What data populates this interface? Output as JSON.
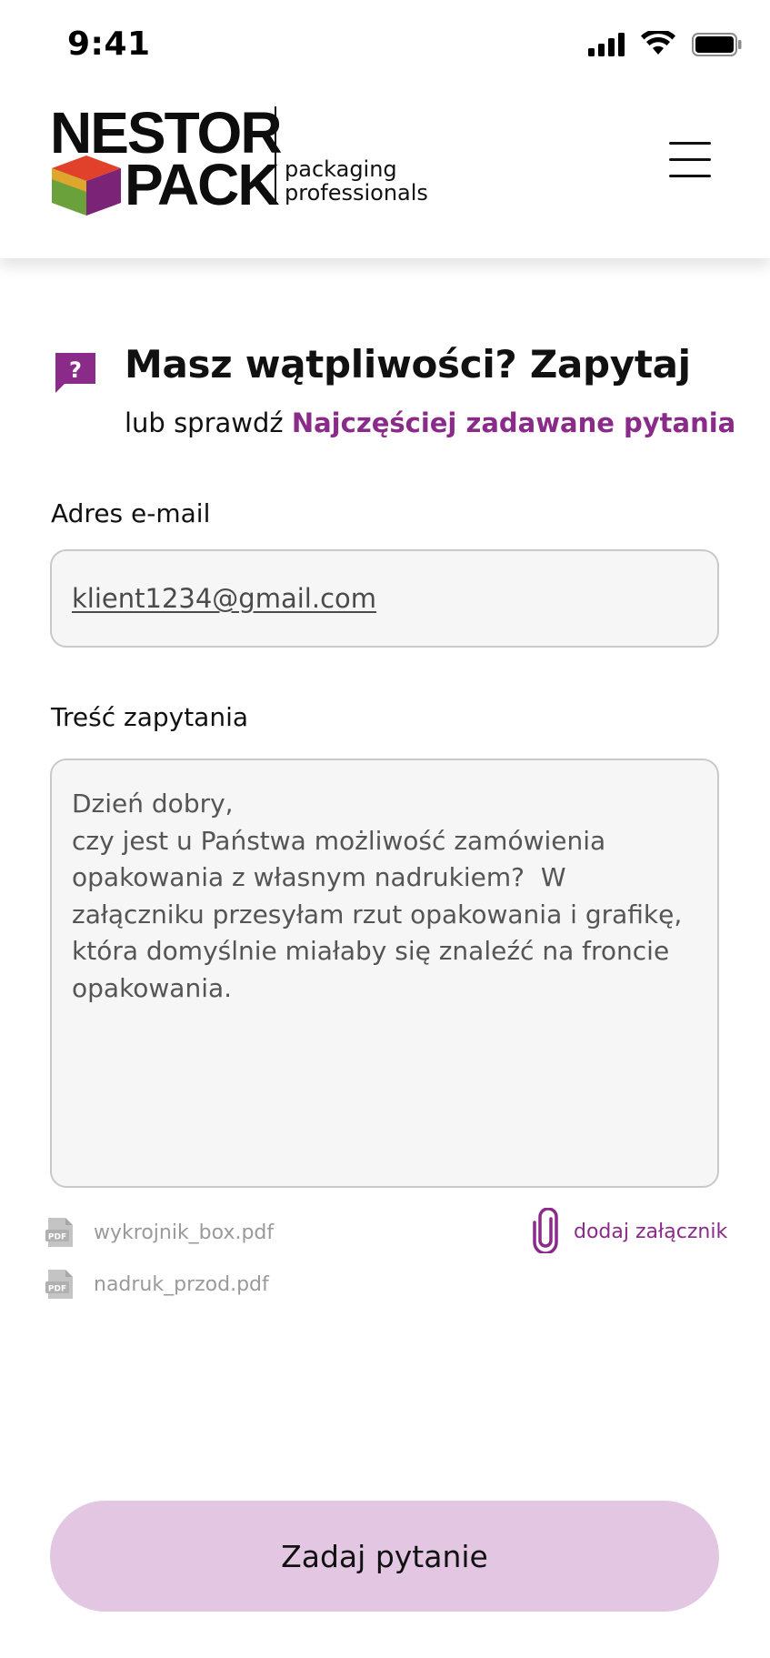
{
  "status_bar": {
    "time": "9:41",
    "icons": [
      "signal-icon",
      "wifi-icon",
      "battery-icon"
    ]
  },
  "header": {
    "logo": {
      "word_top": "NESTOR",
      "word_bottom": "PACK",
      "tagline_line1": "packaging",
      "tagline_line2": "professionals"
    },
    "menu_icon": "hamburger-menu-icon"
  },
  "heading": {
    "icon": "question-chat-icon",
    "title": "Masz wątpliwości? Zapytaj",
    "subtitle_prefix": "lub sprawdź ",
    "faq_link": "Najczęściej zadawane pytania"
  },
  "form": {
    "email": {
      "label": "Adres e-mail",
      "value": "klient1234@gmail.com"
    },
    "message": {
      "label": "Treść zapytania",
      "value": "Dzień dobry,\nczy jest u Państwa możliwość zamówienia opakowania z własnym nadrukiem?  W załączniku przesyłam rzut opakowania i grafikę, która domyślnie miałaby się znaleźć na froncie opakowania."
    },
    "attachments": [
      {
        "name": "wykrojnik_box.pdf",
        "icon": "pdf-file-icon"
      },
      {
        "name": "nadruk_przod.pdf",
        "icon": "pdf-file-icon"
      }
    ],
    "add_attachment": {
      "label": "dodaj załącznik",
      "icon": "paperclip-icon"
    },
    "submit_label": "Zadaj pytanie"
  },
  "colors": {
    "accent": "#8a2b8a",
    "button_bg": "#e2c6e2",
    "field_bg": "#f6f6f6",
    "field_border": "#c9c9c9",
    "muted_text": "#9a9a9a"
  }
}
